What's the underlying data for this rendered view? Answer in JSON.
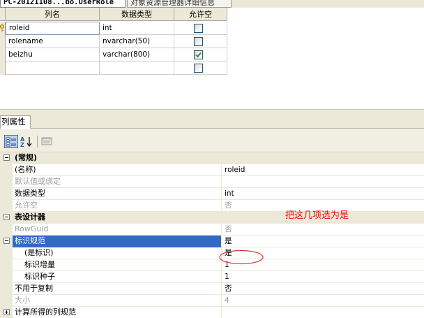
{
  "tabs": [
    {
      "label": "PC-20121108...bo.UserRole",
      "active": true
    },
    {
      "label": "对象资源管理器详细信息",
      "active": false
    }
  ],
  "column_grid": {
    "headers": [
      "列名",
      "数据类型",
      "允许空"
    ],
    "rows": [
      {
        "name": "roleid",
        "type": "int",
        "nullable": false,
        "is_key": true
      },
      {
        "name": "rolename",
        "type": "nvarchar(50)",
        "nullable": false,
        "is_key": false
      },
      {
        "name": "beizhu",
        "type": "varchar(800)",
        "nullable": true,
        "is_key": false
      },
      {
        "name": "",
        "type": "",
        "nullable": false,
        "is_key": false
      }
    ]
  },
  "properties": {
    "tab_label": "列属性",
    "toolbar": {
      "categorized_icon": "categorized-icon",
      "alphabetical_icon": "az-sort-icon",
      "property_pages_icon": "property-pages-icon"
    },
    "rows": [
      {
        "name": "(常规)",
        "value": "",
        "kind": "category",
        "expander": "minus"
      },
      {
        "name": "(名称)",
        "value": "roleid",
        "kind": "normal"
      },
      {
        "name": "默认值或绑定",
        "value": "",
        "kind": "disabled"
      },
      {
        "name": "数据类型",
        "value": "int",
        "kind": "normal"
      },
      {
        "name": "允许空",
        "value": "否",
        "kind": "disabled"
      },
      {
        "name": "表设计器",
        "value": "",
        "kind": "category",
        "expander": "minus"
      },
      {
        "name": "RowGuid",
        "value": "否",
        "kind": "disabled"
      },
      {
        "name": "标识规范",
        "value": "是",
        "kind": "selected",
        "expander": "minus"
      },
      {
        "name": "(是标识)",
        "value": "是",
        "kind": "indent"
      },
      {
        "name": "标识增量",
        "value": "1",
        "kind": "indent"
      },
      {
        "name": "标识种子",
        "value": "1",
        "kind": "indent"
      },
      {
        "name": "不用于复制",
        "value": "否",
        "kind": "normal"
      },
      {
        "name": "大小",
        "value": "4",
        "kind": "disabled"
      },
      {
        "name": "计算所得的列规范",
        "value": "",
        "kind": "normal",
        "expander": "plus"
      }
    ]
  },
  "annotation": {
    "text": "把这几项选为是",
    "color": "#ff0000"
  },
  "colors": {
    "selection": "#316ac5",
    "chrome": "#ece9d8"
  }
}
